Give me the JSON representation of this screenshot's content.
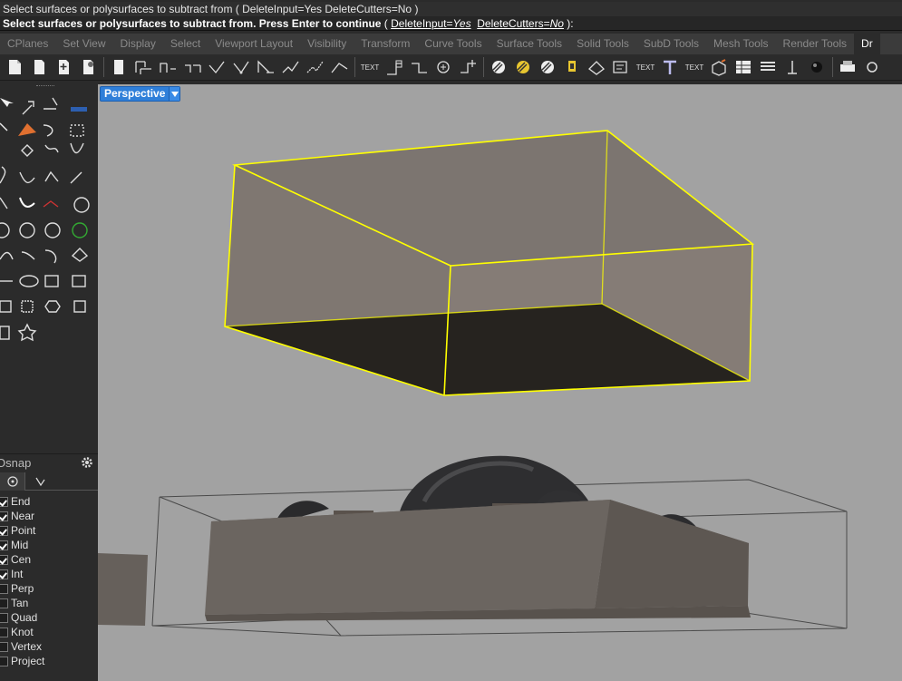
{
  "command": {
    "history_line": "Select surfaces or polysurfaces to subtract from ( DeleteInput=Yes  DeleteCutters=No )",
    "prompt_main": "Select surfaces or polysurfaces to subtract from. Press Enter to continue",
    "prompt_open": " ( ",
    "opt1_name": "DeleteInput",
    "opt1_value": "Yes",
    "opt2_name": "DeleteCutters",
    "opt2_value": "No",
    "prompt_close": " ):"
  },
  "tabs": [
    "CPlanes",
    "Set View",
    "Display",
    "Select",
    "Viewport Layout",
    "Visibility",
    "Transform",
    "Curve Tools",
    "Surface Tools",
    "Solid Tools",
    "SubD Tools",
    "Mesh Tools",
    "Render Tools",
    "Dr"
  ],
  "active_tab_index": 13,
  "toolbar": {
    "text_label_1": "TEXT",
    "text_label_2": "TEXT",
    "text_label_3": "TEXT",
    "text_label_4": "TEXT"
  },
  "viewport": {
    "title": "Perspective",
    "menu_icon": "triangle-down-icon",
    "background_color": "#a2a2a2",
    "selection_color": "#ffff00"
  },
  "osnap": {
    "title": "Osnap",
    "gear_icon": "gear-icon",
    "items": [
      {
        "label": "End",
        "checked": true
      },
      {
        "label": "Near",
        "checked": true
      },
      {
        "label": "Point",
        "checked": true
      },
      {
        "label": "Mid",
        "checked": true
      },
      {
        "label": "Cen",
        "checked": true
      },
      {
        "label": "Int",
        "checked": true
      },
      {
        "label": "Perp",
        "checked": false
      },
      {
        "label": "Tan",
        "checked": false
      },
      {
        "label": "Quad",
        "checked": false
      },
      {
        "label": "Knot",
        "checked": false
      },
      {
        "label": "Vertex",
        "checked": false
      },
      {
        "label": "Project",
        "checked": false
      }
    ]
  }
}
